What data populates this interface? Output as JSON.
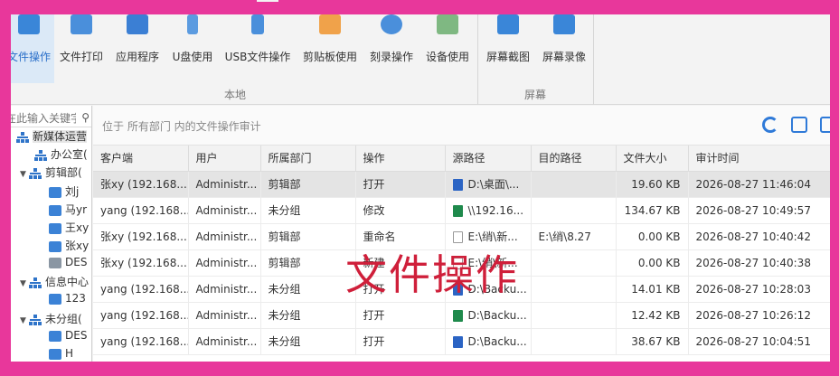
{
  "ribbon": {
    "buttons": [
      {
        "label": "文件操作",
        "icon": "file-operation-icon",
        "active": true
      },
      {
        "label": "文件打印",
        "icon": "printer-icon"
      },
      {
        "label": "应用程序",
        "icon": "code-window-icon"
      },
      {
        "label": "U盘使用",
        "icon": "usb-drive-icon"
      },
      {
        "label": "USB文件操作",
        "icon": "usb-file-icon"
      },
      {
        "label": "剪贴板使用",
        "icon": "clipboard-icon"
      },
      {
        "label": "刻录操作",
        "icon": "disc-burn-icon"
      },
      {
        "label": "设备使用",
        "icon": "device-check-icon"
      },
      {
        "label": "屏幕截图",
        "icon": "camera-icon"
      },
      {
        "label": "屏幕录像",
        "icon": "video-camera-icon"
      }
    ],
    "group_local": "本地",
    "group_screen": "屏幕"
  },
  "tree": {
    "search_placeholder": "在此输入关键字",
    "nodes": [
      {
        "label": "新媒体运营",
        "icon": "org-icon"
      },
      {
        "label": "办公室(",
        "icon": "org-icon"
      },
      {
        "label": "剪辑部(",
        "icon": "org-icon"
      },
      {
        "label": "刘j",
        "icon": "computer-icon"
      },
      {
        "label": "马yr",
        "icon": "computer-icon"
      },
      {
        "label": "王xy",
        "icon": "computer-icon"
      },
      {
        "label": "张xy",
        "icon": "computer-icon"
      },
      {
        "label": "DES",
        "icon": "computer-icon"
      },
      {
        "label": "信息中心",
        "icon": "org-icon"
      },
      {
        "label": "123",
        "icon": "computer-icon"
      },
      {
        "label": "未分组(",
        "icon": "org-icon"
      },
      {
        "label": "DES",
        "icon": "computer-icon"
      },
      {
        "label": "H",
        "icon": "computer-icon"
      }
    ]
  },
  "main": {
    "path_text": "位于 所有部门 内的文件操作审计",
    "columns": [
      "客户端",
      "用户",
      "所属部门",
      "操作",
      "源路径",
      "目的路径",
      "文件大小",
      "审计时间"
    ],
    "rows": [
      {
        "client": "张xy (192.168....",
        "user": "Administr...",
        "dept": "剪辑部",
        "op": "打开",
        "src": "D:\\桌面\\...",
        "src_type": "doc",
        "dst": "",
        "size": "19.60 KB",
        "time": "2026-08-27 11:46:04"
      },
      {
        "client": "yang (192.168....",
        "user": "Administr...",
        "dept": "未分组",
        "op": "修改",
        "src": "\\\\192.16...",
        "src_type": "xls",
        "dst": "",
        "size": "134.67 KB",
        "time": "2026-08-27 10:49:57"
      },
      {
        "client": "张xy (192.168....",
        "user": "Administr...",
        "dept": "剪辑部",
        "op": "重命名",
        "src": "E:\\绡\\新...",
        "src_type": "blank",
        "dst": "E:\\绡\\8.27",
        "size": "0.00 KB",
        "time": "2026-08-27 10:40:42"
      },
      {
        "client": "张xy (192.168....",
        "user": "Administr...",
        "dept": "剪辑部",
        "op": "新建",
        "src": "E:\\绡\\新...",
        "src_type": "blank",
        "dst": "",
        "size": "0.00 KB",
        "time": "2026-08-27 10:40:38"
      },
      {
        "client": "yang (192.168....",
        "user": "Administr...",
        "dept": "未分组",
        "op": "打开",
        "src": "D:\\Backu...",
        "src_type": "doc",
        "dst": "",
        "size": "14.01 KB",
        "time": "2026-08-27 10:28:03"
      },
      {
        "client": "yang (192.168....",
        "user": "Administr...",
        "dept": "未分组",
        "op": "打开",
        "src": "D:\\Backu...",
        "src_type": "xls",
        "dst": "",
        "size": "12.42 KB",
        "time": "2026-08-27 10:26:12"
      },
      {
        "client": "yang (192.168....",
        "user": "Administr...",
        "dept": "未分组",
        "op": "打开",
        "src": "D:\\Backu...",
        "src_type": "doc",
        "dst": "",
        "size": "38.67 KB",
        "time": "2026-08-27 10:04:51"
      }
    ]
  },
  "overlay_text": "文件操作",
  "colors": {
    "accent": "#2f7ad8",
    "frame": "#e8379b",
    "overlay": "#cf1f3a"
  }
}
